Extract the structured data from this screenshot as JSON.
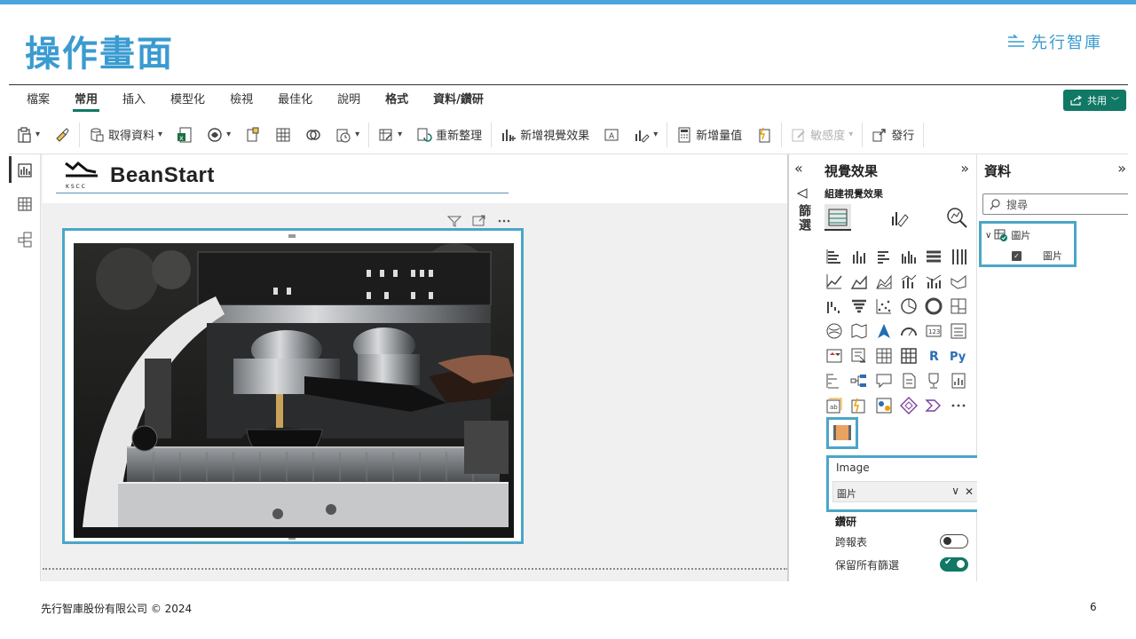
{
  "slide": {
    "title": "操作畫面",
    "brand": "先行智庫",
    "footer": "先行智庫股份有限公司 © 2024",
    "page_number": "6"
  },
  "menubar": {
    "tabs": [
      {
        "label": "檔案",
        "active": false
      },
      {
        "label": "常用",
        "active": true
      },
      {
        "label": "插入",
        "active": false
      },
      {
        "label": "模型化",
        "active": false
      },
      {
        "label": "檢視",
        "active": false
      },
      {
        "label": "最佳化",
        "active": false
      },
      {
        "label": "說明",
        "active": false
      },
      {
        "label": "格式",
        "active": false
      },
      {
        "label": "資料/鑽研",
        "active": false
      }
    ],
    "share_label": "共用"
  },
  "ribbon": {
    "get_data": "取得資料",
    "refresh": "重新整理",
    "new_visual": "新增視覺效果",
    "new_measure": "新增量值",
    "sensitivity": "敏感度",
    "publish": "發行"
  },
  "report": {
    "logo_text": "BeanStart",
    "logo_sub": "K S C C"
  },
  "filters": {
    "label": "篩選"
  },
  "visualizations": {
    "title": "視覺效果",
    "build_label": "組建視覺效果",
    "well_label": "Image",
    "well_value": "圖片",
    "drill_label": "鑽研",
    "cross_report_label": "跨報表",
    "keep_filters_label": "保留所有篩選",
    "cross_report_on": false,
    "keep_filters_on": true
  },
  "data": {
    "title": "資料",
    "search_placeholder": "搜尋",
    "table_name": "圖片",
    "field_name": "圖片"
  },
  "colors": {
    "accent_blue": "#3a9bd0",
    "highlight_border": "#4aa6c8",
    "pbi_green": "#117865"
  }
}
